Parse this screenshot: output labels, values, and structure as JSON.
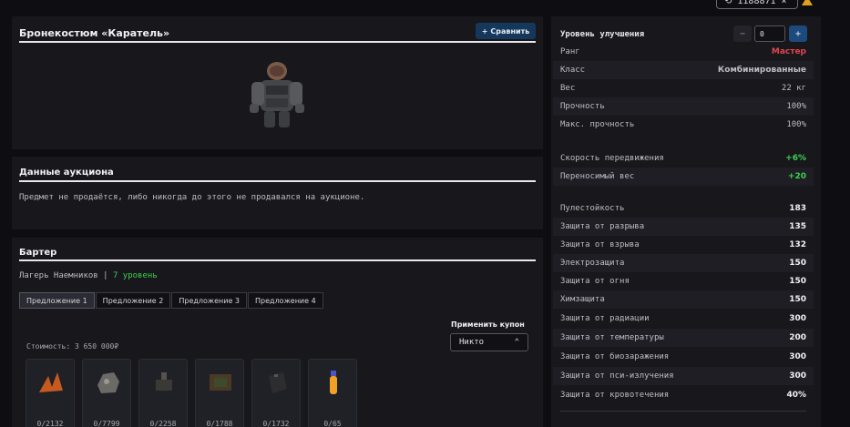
{
  "top": {
    "history_label": "1188871",
    "close_glyph": "×"
  },
  "item": {
    "title": "Бронекостюм «Каратель»",
    "compare_label": "Сравнить",
    "compare_icon": "plus-icon"
  },
  "auction": {
    "title": "Данные аукциона",
    "message": "Предмет не продаётся, либо никогда до этого не продавался на аукционе."
  },
  "barter": {
    "title": "Бартер",
    "camp": "Лагерь Наемников",
    "separator": "|",
    "level": "7 уровень",
    "tabs": [
      "Предложение 1",
      "Предложение 2",
      "Предложение 3",
      "Предложение 4"
    ],
    "active_tab": 0,
    "coupon_label": "Применить купон",
    "coupon_value": "Никто",
    "cost": "Стоимость: 3 650 000₽",
    "slots": [
      {
        "count": "0/2132",
        "icon": "orange-leaf-icon"
      },
      {
        "count": "0/7799",
        "icon": "ore-chunk-icon"
      },
      {
        "count": "0/2258",
        "icon": "device-icon"
      },
      {
        "count": "0/1788",
        "icon": "circuit-board-icon"
      },
      {
        "count": "0/1732",
        "icon": "battery-box-icon"
      },
      {
        "count": "0/65",
        "icon": "vial-icon"
      }
    ]
  },
  "stats": {
    "upgrade_label": "Уровень улучшения",
    "upgrade_value": "0",
    "minus": "−",
    "plus": "+",
    "general": [
      {
        "label": "Ранг",
        "value": "Мастер",
        "color": "#e0464e"
      },
      {
        "label": "Класс",
        "value": "Комбинированные",
        "color": "#bdbdc3"
      },
      {
        "label": "Вес",
        "value": "22 кг",
        "color": "#bdbdc3"
      },
      {
        "label": "Прочность",
        "value": "100%",
        "color": "#bdbdc3"
      },
      {
        "label": "Макс. прочность",
        "value": "100%",
        "color": "#bdbdc3"
      }
    ],
    "bonuses": [
      {
        "label": "Скорость передвижения",
        "value": "+6%",
        "color": "#3fd04f"
      },
      {
        "label": "Переносимый вес",
        "value": "+20",
        "color": "#3fd04f"
      }
    ],
    "protection": [
      {
        "label": "Пулестойкость",
        "value": "183"
      },
      {
        "label": "Защита от разрыва",
        "value": "135"
      },
      {
        "label": "Защита от взрыва",
        "value": "132"
      },
      {
        "label": "Электрозащита",
        "value": "150"
      },
      {
        "label": "Защита от огня",
        "value": "150"
      },
      {
        "label": "Химзащита",
        "value": "150"
      },
      {
        "label": "Защита от радиации",
        "value": "300"
      },
      {
        "label": "Защита от температуры",
        "value": "200"
      },
      {
        "label": "Защита от биозаражения",
        "value": "300"
      },
      {
        "label": "Защита от пси-излучения",
        "value": "300"
      },
      {
        "label": "Защита от кровотечения",
        "value": "40%"
      }
    ]
  }
}
